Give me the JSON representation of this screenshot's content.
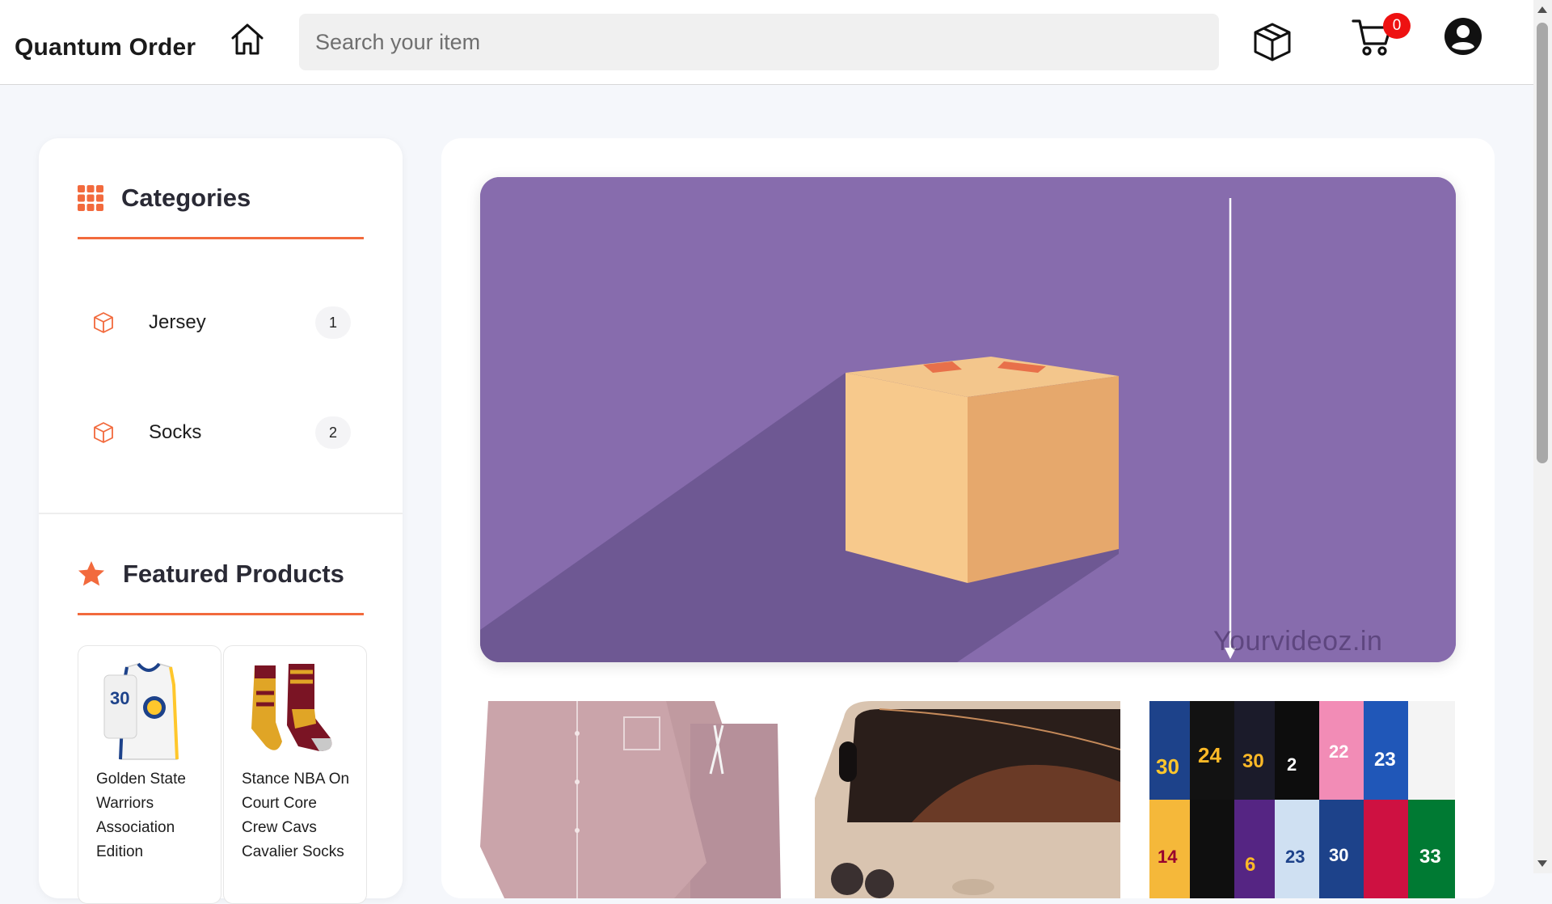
{
  "header": {
    "brand": "Quantum Order",
    "search_placeholder": "Search your item",
    "cart_count": "0"
  },
  "categories": {
    "title": "Categories",
    "items": [
      {
        "label": "Jersey",
        "count": "1"
      },
      {
        "label": "Socks",
        "count": "2"
      }
    ]
  },
  "featured": {
    "title": "Featured Products",
    "products": [
      {
        "name": "Golden State Warriors Association Edition"
      },
      {
        "name": "Stance NBA On Court Core Crew Cavs Cavalier Socks"
      }
    ]
  },
  "banner": {
    "watermark": "Yourvideoz.in"
  },
  "colors": {
    "accent": "#f26a3d",
    "banner_bg": "#876cad",
    "badge": "#ee1111"
  },
  "icons": {
    "home": "home-icon",
    "orders": "box-icon",
    "cart": "cart-icon",
    "profile": "user-icon",
    "categories": "grid-icon",
    "featured": "star-icon"
  }
}
